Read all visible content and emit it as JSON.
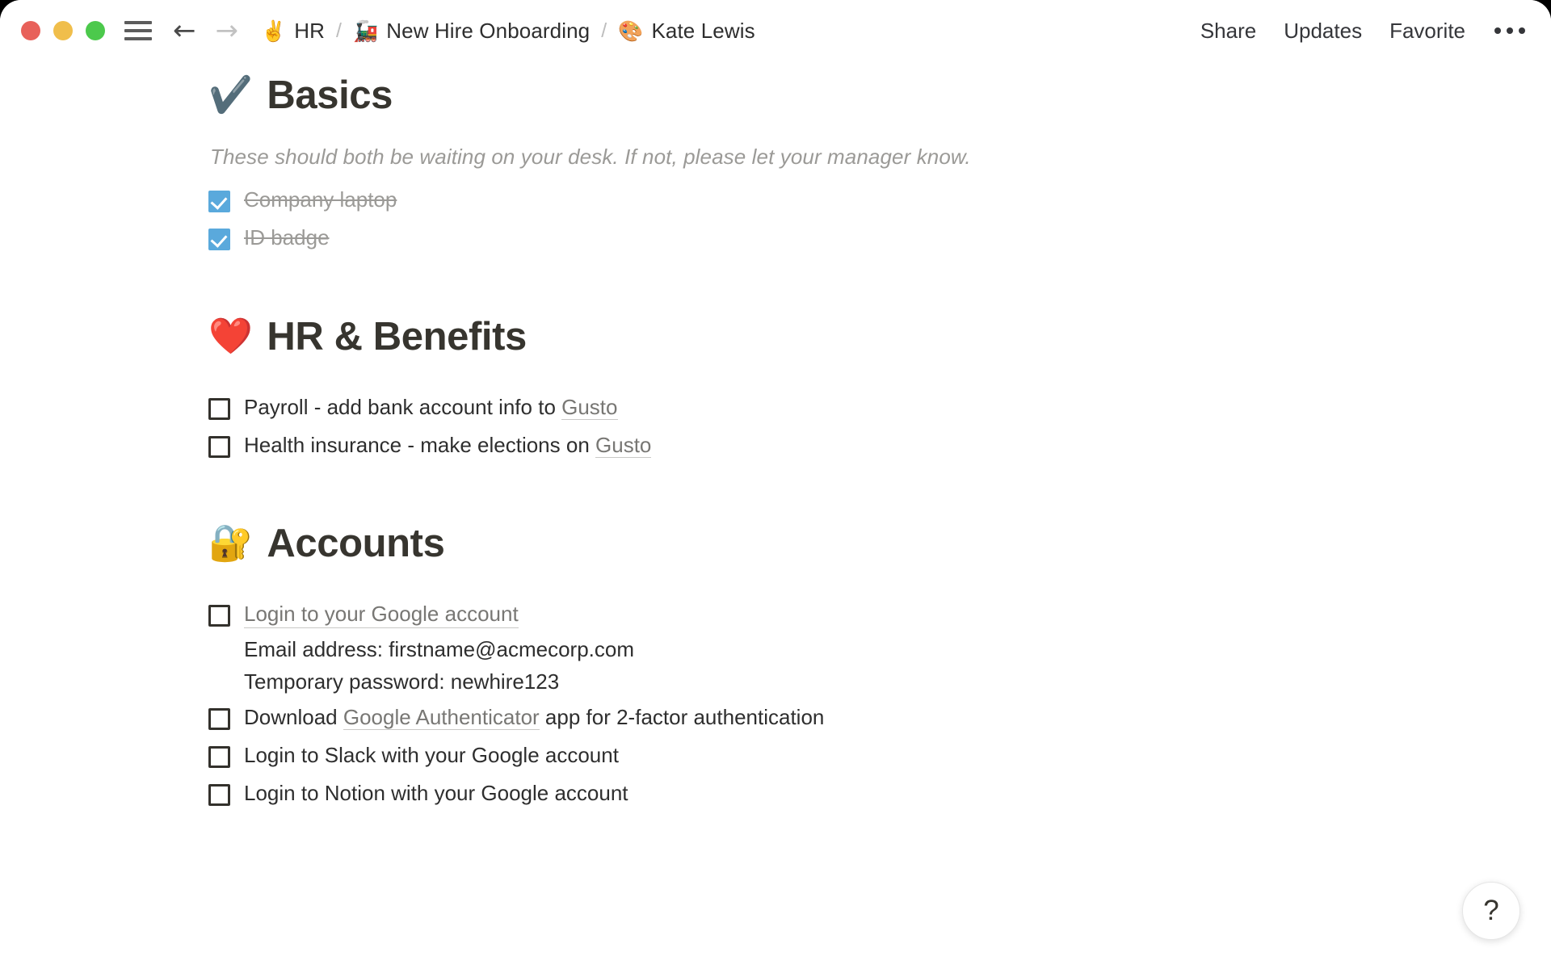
{
  "window": {
    "traffic_lights": [
      {
        "name": "close",
        "color": "#E8615A"
      },
      {
        "name": "minimize",
        "color": "#F0BE4B"
      },
      {
        "name": "maximize",
        "color": "#4CC94C"
      }
    ]
  },
  "topbar": {
    "back_glyph": "←",
    "forward_glyph": "→",
    "breadcrumbs": [
      {
        "emoji": "✌️",
        "label": "HR"
      },
      {
        "emoji": "🚂",
        "label": "New Hire Onboarding"
      },
      {
        "emoji": "🎨",
        "label": "Kate Lewis"
      }
    ],
    "separator": "/",
    "actions": [
      {
        "label": "Share"
      },
      {
        "label": "Updates"
      },
      {
        "label": "Favorite"
      }
    ]
  },
  "sections": [
    {
      "emoji": "✔️",
      "title": "Basics",
      "caption": "These should both be waiting on your desk. If not, please let your manager know.",
      "items": [
        {
          "text": "Company laptop",
          "checked": true
        },
        {
          "text": "ID badge",
          "checked": true
        }
      ]
    },
    {
      "emoji": "❤️",
      "title": "HR & Benefits",
      "items": [
        {
          "text_before": "Payroll - add bank account info to ",
          "link": "Gusto",
          "text_after": "",
          "checked": false
        },
        {
          "text_before": "Health insurance - make elections on ",
          "link": "Gusto",
          "text_after": "",
          "checked": false
        }
      ]
    },
    {
      "emoji": "🔐",
      "title": "Accounts",
      "items": [
        {
          "text": "Login to your Google account",
          "checked": false,
          "whole_link": true,
          "sublines": [
            "Email address: firstname@acmecorp.com",
            "Temporary password: newhire123"
          ]
        },
        {
          "text_before": "Download ",
          "link": "Google Authenticator",
          "text_after": " app for 2-factor authentication",
          "checked": false
        },
        {
          "text": "Login to Slack with your Google account",
          "checked": false
        },
        {
          "text": "Login to Notion with your Google account",
          "checked": false
        }
      ]
    }
  ],
  "help_button": {
    "glyph": "?"
  },
  "colors": {
    "checkbox_checked": "#5AA9DC",
    "link_text": "#787774",
    "body_text": "#2E2E2E",
    "caption_text": "#9B9A97"
  }
}
